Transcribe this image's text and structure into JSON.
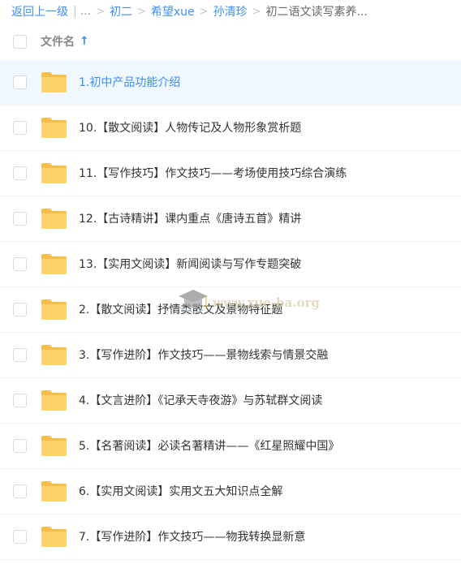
{
  "breadcrumb": {
    "back_label": "返回上一级",
    "ellipsis": "...",
    "items": [
      "初二",
      "希望xue",
      "孙清珍"
    ],
    "current": "初二语文读写素养..."
  },
  "header": {
    "column_label": "文件名",
    "sort_icon": "sort-ascending-arrow-icon"
  },
  "files": [
    {
      "name": "1.初中产品功能介绍",
      "selected": true
    },
    {
      "name": "10.【散文阅读】人物传记及人物形象赏析题"
    },
    {
      "name": "11.【写作技巧】作文技巧——考场使用技巧综合演练"
    },
    {
      "name": "12.【古诗精讲】课内重点《唐诗五首》精讲"
    },
    {
      "name": "13.【实用文阅读】新闻阅读与写作专题突破"
    },
    {
      "name": "2.【散文阅读】抒情类散文及景物特征题"
    },
    {
      "name": "3.【写作进阶】作文技巧——景物线索与情景交融"
    },
    {
      "name": "4.【文言进阶】《记承天寺夜游》与苏轼群文阅读"
    },
    {
      "name": "5.【名著阅读】必读名著精讲——《红星照耀中国》"
    },
    {
      "name": "6.【实用文阅读】实用文五大知识点全解"
    },
    {
      "name": "7.【写作进阶】作文技巧——物我转换显新意"
    }
  ],
  "watermark": {
    "text": "www.xue-ba.org"
  },
  "colors": {
    "link": "#3b8cff",
    "folder": "#ffd36b",
    "folder_tab": "#f5c04a",
    "selected_row": "#f0f8ff"
  }
}
